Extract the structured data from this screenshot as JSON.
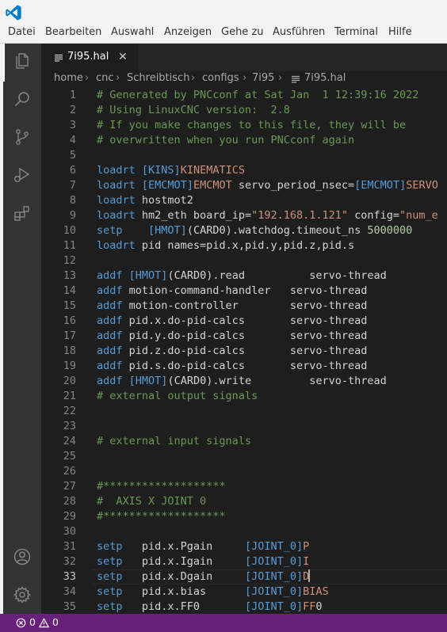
{
  "menubar": [
    "Datei",
    "Bearbeiten",
    "Auswahl",
    "Anzeigen",
    "Gehe zu",
    "Ausführen",
    "Terminal",
    "Hilfe"
  ],
  "tab": {
    "label": "7i95.hal",
    "close": "✕"
  },
  "breadcrumb": [
    "home",
    "cnc",
    "Schreibtisch",
    "configs",
    "7i95",
    "7i95.hal"
  ],
  "code_lines": [
    {
      "n": "1",
      "text": "# Generated by PNCconf at Sat Jan  1 12:39:16 2022"
    },
    {
      "n": "2",
      "text": "# Using LinuxCNC version:  2.8"
    },
    {
      "n": "3",
      "text": "# If you make changes to this file, they will be"
    },
    {
      "n": "4",
      "text": "# overwritten when you run PNCconf again"
    },
    {
      "n": "5",
      "text": ""
    },
    {
      "n": "6",
      "text": "loadrt [KINS]KINEMATICS"
    },
    {
      "n": "7",
      "text": "loadrt [EMCMOT]EMCMOT servo_period_nsec=[EMCMOT]SERVO"
    },
    {
      "n": "8",
      "text": "loadrt hostmot2"
    },
    {
      "n": "9",
      "text": "loadrt hm2_eth board_ip=\"192.168.1.121\" config=\"num_e"
    },
    {
      "n": "10",
      "text": "setp    [HMOT](CARD0).watchdog.timeout_ns 5000000"
    },
    {
      "n": "11",
      "text": "loadrt pid names=pid.x,pid.y,pid.z,pid.s"
    },
    {
      "n": "12",
      "text": ""
    },
    {
      "n": "13",
      "text": "addf [HMOT](CARD0).read          servo-thread"
    },
    {
      "n": "14",
      "text": "addf motion-command-handler   servo-thread"
    },
    {
      "n": "15",
      "text": "addf motion-controller        servo-thread"
    },
    {
      "n": "16",
      "text": "addf pid.x.do-pid-calcs       servo-thread"
    },
    {
      "n": "17",
      "text": "addf pid.y.do-pid-calcs       servo-thread"
    },
    {
      "n": "18",
      "text": "addf pid.z.do-pid-calcs       servo-thread"
    },
    {
      "n": "19",
      "text": "addf pid.s.do-pid-calcs       servo-thread"
    },
    {
      "n": "20",
      "text": "addf [HMOT](CARD0).write         servo-thread"
    },
    {
      "n": "21",
      "text": "# external output signals"
    },
    {
      "n": "22",
      "text": ""
    },
    {
      "n": "23",
      "text": ""
    },
    {
      "n": "24",
      "text": "# external input signals"
    },
    {
      "n": "25",
      "text": ""
    },
    {
      "n": "26",
      "text": ""
    },
    {
      "n": "27",
      "text": "#*******************"
    },
    {
      "n": "28",
      "text": "#  AXIS X JOINT 0"
    },
    {
      "n": "29",
      "text": "#*******************"
    },
    {
      "n": "30",
      "text": ""
    },
    {
      "n": "31",
      "text": "setp   pid.x.Pgain     [JOINT_0]P"
    },
    {
      "n": "32",
      "text": "setp   pid.x.Igain     [JOINT_0]I"
    },
    {
      "n": "33",
      "text": "setp   pid.x.Dgain     [JOINT_0]D"
    },
    {
      "n": "34",
      "text": "setp   pid.x.bias      [JOINT_0]BIAS"
    },
    {
      "n": "35",
      "text": "setp   pid.x.FF0       [JOINT_0]FF0"
    }
  ],
  "current_line": "33",
  "statusbar": {
    "errors": "0",
    "warnings": "0"
  },
  "colors": {
    "comment": "#6a9955",
    "keyword": "#569cd6",
    "string": "#ce9178",
    "number": "#b5cea8",
    "statusbar": "#68217a",
    "activitybar": "#333333",
    "editor_bg": "#1e1e1e"
  },
  "icons": [
    "vscode-logo-icon",
    "explorer-icon",
    "search-icon",
    "source-control-icon",
    "run-debug-icon",
    "extensions-icon",
    "account-icon",
    "settings-gear-icon",
    "close-icon",
    "hal-file-icon",
    "error-icon",
    "warning-icon"
  ]
}
